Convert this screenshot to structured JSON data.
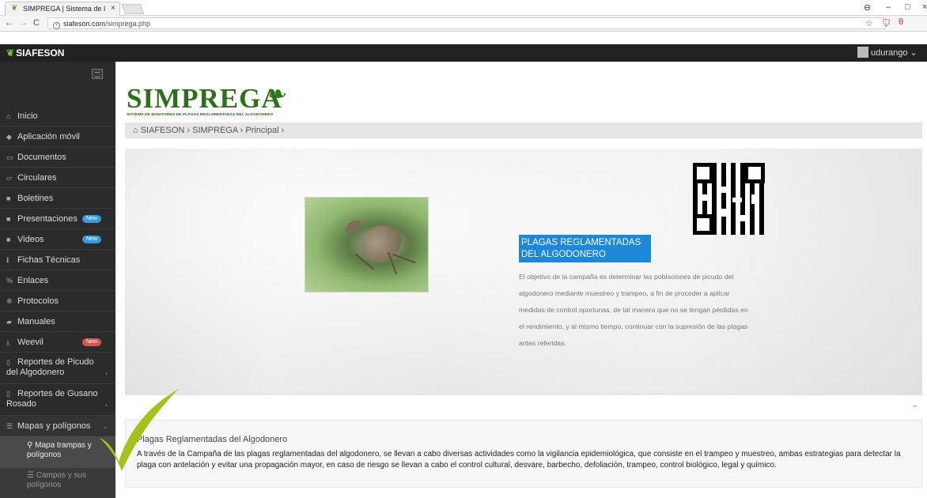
{
  "browser": {
    "tab_title": "SIMPREGA | Sistema de I",
    "tab_close": "×",
    "url_host": "siafeson.com",
    "url_path": "/simprega.php",
    "min": "–",
    "max": "□",
    "close": "×"
  },
  "app": {
    "brand": "SIAFESON",
    "user": "udurango ⌄"
  },
  "sidebar": {
    "items": [
      {
        "label": "Inicio"
      },
      {
        "label": "Aplicación móvil"
      },
      {
        "label": "Documentos"
      },
      {
        "label": "Circulares"
      },
      {
        "label": "Boletines"
      },
      {
        "label": "Presentaciones",
        "badge": "New"
      },
      {
        "label": "Videos",
        "badge": "New"
      },
      {
        "label": "Fichas Técnicas"
      },
      {
        "label": "Enlaces"
      },
      {
        "label": "Protocolos"
      },
      {
        "label": "Manuales"
      },
      {
        "label": "Weevil",
        "badge": "New"
      },
      {
        "label": "Reportes de Picudo del Algodonero"
      },
      {
        "label": "Reportes de Gusano Rosado"
      },
      {
        "label": "Mapas y polígonos"
      }
    ],
    "sub_items": [
      {
        "label": "Mapa trampas y polígonos"
      },
      {
        "label": "Campos y sus polígonos"
      }
    ]
  },
  "header": {
    "logo_word": "SIMPREGA",
    "logo_sub": "SISTEMA DE MONITOREO DE PLAGAS REGLAMENTADAS DEL ALGODONERO",
    "breadcrumb": "SIAFESON › SIMPREGA › Principal ›"
  },
  "hero": {
    "title": "PLAGAS REGLAMENTADAS DEL ALGODONERO",
    "body": "El objetivo de la campaña es determinar las poblaciones de picudo del algodonero mediante muestreo y trampeo, a fin de proceder a aplicar medidas de control oportunas, de tal manera que no se tengan pérdidas en el rendimiento, y al mismo tiempo, continuar con la supresión de las plagas antes referidas."
  },
  "info": {
    "title": "Plagas Reglamentadas del Algodonero",
    "text": "A través de la Campaña de las plagas reglamentadas del algodonero, se llevan a cabo diversas actividades como la vigilancia epidemiológica, que consiste en el trampeo y muestreo, ambas estrategias para detectar la plaga con antelación y evitar una propagación mayor, en caso de riesgo se llevan a cabo el control cultural, desvare, barbecho, defoliación, trampeo, control biológico, legal y químico."
  },
  "colors": {
    "accent": "#1e88d8",
    "sidebar": "#2b2b2b",
    "brand_green": "#2f6e1b",
    "check_green": "#a4c21a"
  }
}
